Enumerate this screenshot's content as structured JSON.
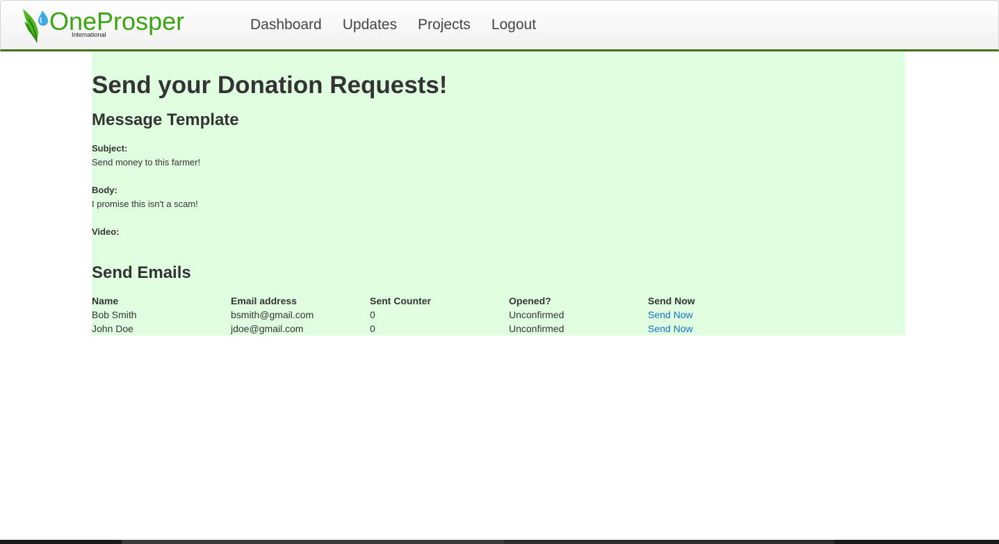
{
  "brand": {
    "name": "OneProsper",
    "subtitle": "International"
  },
  "nav": {
    "items": [
      {
        "label": "Dashboard"
      },
      {
        "label": "Updates"
      },
      {
        "label": "Projects"
      },
      {
        "label": "Logout"
      }
    ]
  },
  "page": {
    "title": "Send your Donation Requests!",
    "template_heading": "Message Template",
    "subject_label": "Subject:",
    "subject_value": "Send money to this farmer!",
    "body_label": "Body:",
    "body_value": "I promise this isn't a scam!",
    "video_label": "Video:",
    "send_heading": "Send Emails"
  },
  "table": {
    "headers": [
      "Name",
      "Email address",
      "Sent Counter",
      "Opened?",
      "Send Now"
    ],
    "rows": [
      {
        "name": "Bob Smith",
        "email": "bsmith@gmail.com",
        "sent_counter": "0",
        "opened": "Unconfirmed",
        "action": "Send Now"
      },
      {
        "name": "John Doe",
        "email": "jdoe@gmail.com",
        "sent_counter": "0",
        "opened": "Unconfirmed",
        "action": "Send Now"
      }
    ]
  },
  "colors": {
    "brand_green": "#3aa312",
    "nav_border": "#3e7018",
    "content_background": "#e0fee0",
    "link_blue": "#0f71c4"
  },
  "icons": {
    "logo": "leaf-with-water-drop-icon"
  }
}
